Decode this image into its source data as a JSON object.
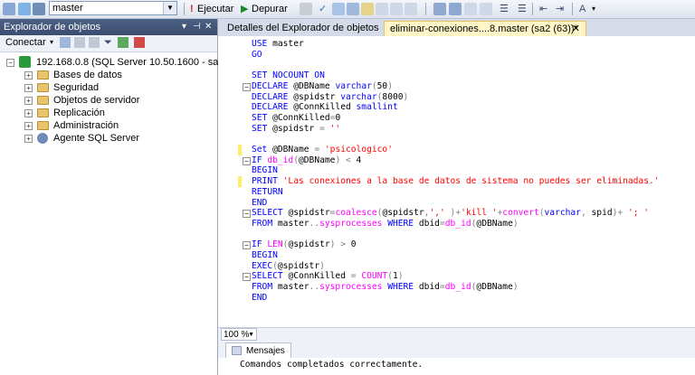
{
  "toolbar": {
    "database": "master",
    "execute_label": "Ejecutar",
    "debug_label": "Depurar"
  },
  "explorer": {
    "title": "Explorador de objetos",
    "connect_label": "Conectar",
    "server": "192.168.0.8 (SQL Server 10.50.1600 - sa2)",
    "nodes": [
      "Bases de datos",
      "Seguridad",
      "Objetos de servidor",
      "Replicación",
      "Administración",
      "Agente SQL Server"
    ]
  },
  "tabs": {
    "details": "Detalles del Explorador de objetos",
    "query": "eliminar-conexiones....8.master (sa2 (63))*",
    "close": "✕"
  },
  "code_lines": [
    {
      "t": [
        [
          "k",
          "USE "
        ],
        [
          "n",
          "master"
        ]
      ]
    },
    {
      "t": [
        [
          "k",
          "GO"
        ]
      ]
    },
    {
      "t": []
    },
    {
      "t": [
        [
          "k",
          "SET NOCOUNT ON"
        ]
      ]
    },
    {
      "t": [
        [
          "k",
          "DECLARE "
        ],
        [
          "n",
          "@DBName "
        ],
        [
          "k",
          "varchar"
        ],
        [
          "g",
          "("
        ],
        [
          "n",
          "50"
        ],
        [
          "g",
          ")"
        ]
      ]
    },
    {
      "t": [
        [
          "k",
          "DECLARE "
        ],
        [
          "n",
          "@spidstr "
        ],
        [
          "k",
          "varchar"
        ],
        [
          "g",
          "("
        ],
        [
          "n",
          "8000"
        ],
        [
          "g",
          ")"
        ]
      ]
    },
    {
      "t": [
        [
          "k",
          "DECLARE "
        ],
        [
          "n",
          "@ConnKilled "
        ],
        [
          "k",
          "smallint"
        ]
      ]
    },
    {
      "t": [
        [
          "k",
          "SET "
        ],
        [
          "n",
          "@ConnKilled"
        ],
        [
          "g",
          "="
        ],
        [
          "n",
          "0"
        ]
      ]
    },
    {
      "t": [
        [
          "k",
          "SET "
        ],
        [
          "n",
          "@spidstr "
        ],
        [
          "g",
          "= "
        ],
        [
          "s",
          "''"
        ]
      ]
    },
    {
      "t": []
    },
    {
      "t": [
        [
          "k",
          "Set "
        ],
        [
          "n",
          "@DBName "
        ],
        [
          "g",
          "= "
        ],
        [
          "s",
          "'psicologico'"
        ]
      ]
    },
    {
      "t": [
        [
          "k",
          "IF "
        ],
        [
          "f",
          "db_id"
        ],
        [
          "g",
          "("
        ],
        [
          "n",
          "@DBName"
        ],
        [
          "g",
          ") < "
        ],
        [
          "n",
          "4"
        ]
      ]
    },
    {
      "t": [
        [
          "k",
          "BEGIN"
        ]
      ]
    },
    {
      "t": [
        [
          "k",
          "PRINT "
        ],
        [
          "s",
          "'Las conexiones a la base de datos de sistema no puedes ser eliminadas.'"
        ]
      ]
    },
    {
      "t": [
        [
          "k",
          "RETURN"
        ]
      ]
    },
    {
      "t": [
        [
          "k",
          "END"
        ]
      ]
    },
    {
      "t": [
        [
          "k",
          "SELECT "
        ],
        [
          "n",
          "@spidstr"
        ],
        [
          "g",
          "="
        ],
        [
          "f",
          "coalesce"
        ],
        [
          "g",
          "("
        ],
        [
          "n",
          "@spidstr"
        ],
        [
          "g",
          ","
        ],
        [
          "s",
          "','"
        ],
        [
          "g",
          " )+"
        ],
        [
          "s",
          "'kill '"
        ],
        [
          "g",
          "+"
        ],
        [
          "f",
          "convert"
        ],
        [
          "g",
          "("
        ],
        [
          "k",
          "varchar"
        ],
        [
          "g",
          ", "
        ],
        [
          "n",
          "spid"
        ],
        [
          "g",
          ")+ "
        ],
        [
          "s",
          "'; '"
        ]
      ]
    },
    {
      "t": [
        [
          "k",
          "FROM "
        ],
        [
          "n",
          "master"
        ],
        [
          "g",
          ".."
        ],
        [
          "f",
          "sysprocesses "
        ],
        [
          "k",
          "WHERE "
        ],
        [
          "n",
          "dbid"
        ],
        [
          "g",
          "="
        ],
        [
          "f",
          "db_id"
        ],
        [
          "g",
          "("
        ],
        [
          "n",
          "@DBName"
        ],
        [
          "g",
          ")"
        ]
      ]
    },
    {
      "t": []
    },
    {
      "t": [
        [
          "k",
          "IF "
        ],
        [
          "f",
          "LEN"
        ],
        [
          "g",
          "("
        ],
        [
          "n",
          "@spidstr"
        ],
        [
          "g",
          ") > "
        ],
        [
          "n",
          "0"
        ]
      ]
    },
    {
      "t": [
        [
          "k",
          "BEGIN"
        ]
      ]
    },
    {
      "t": [
        [
          "k",
          "EXEC"
        ],
        [
          "g",
          "("
        ],
        [
          "n",
          "@spidstr"
        ],
        [
          "g",
          ")"
        ]
      ]
    },
    {
      "t": [
        [
          "k",
          "SELECT "
        ],
        [
          "n",
          "@ConnKilled "
        ],
        [
          "g",
          "= "
        ],
        [
          "f",
          "COUNT"
        ],
        [
          "g",
          "("
        ],
        [
          "n",
          "1"
        ],
        [
          "g",
          ")"
        ]
      ]
    },
    {
      "t": [
        [
          "k",
          "FROM "
        ],
        [
          "n",
          "master"
        ],
        [
          "g",
          ".."
        ],
        [
          "f",
          "sysprocesses "
        ],
        [
          "k",
          "WHERE "
        ],
        [
          "n",
          "dbid"
        ],
        [
          "g",
          "="
        ],
        [
          "f",
          "db_id"
        ],
        [
          "g",
          "("
        ],
        [
          "n",
          "@DBName"
        ],
        [
          "g",
          ")"
        ]
      ]
    },
    {
      "t": [
        [
          "k",
          "END"
        ]
      ]
    }
  ],
  "zoom": "100 %",
  "messages": {
    "tab": "Mensajes",
    "text": "Comandos completados correctamente."
  }
}
